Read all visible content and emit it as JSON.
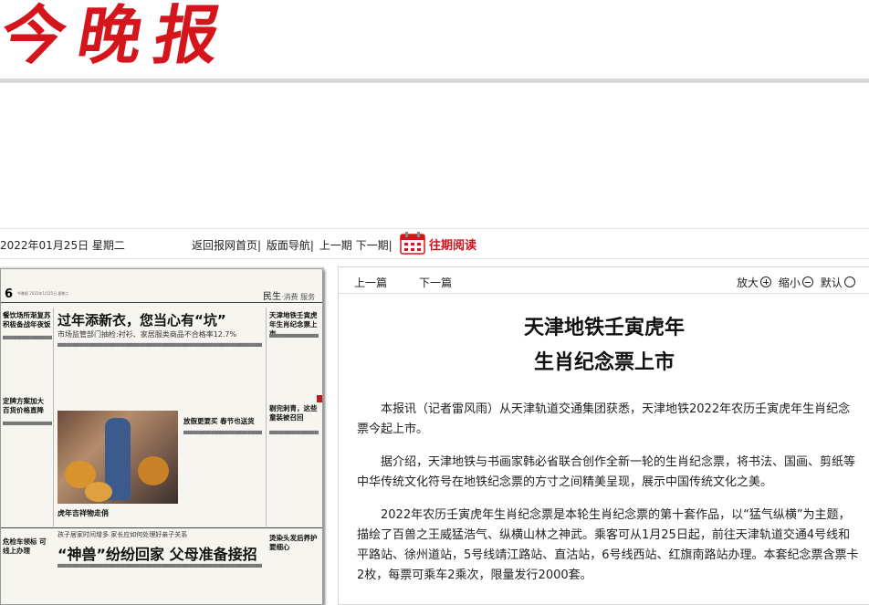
{
  "masthead": {
    "logo_text": "今晚报"
  },
  "nav": {
    "date": "2022年01月25日 星期二",
    "links": [
      "返回报网首页",
      "版面导航",
      "上一期",
      "下一期"
    ],
    "past_reading": "往期阅读"
  },
  "page": {
    "number": "6",
    "section": "民生",
    "section_sub": "·消费 服务",
    "headline_main": "过年添新衣，您当心有“坑”",
    "headline_sub": "市场监管部门抽检:衬衫、家居服类商品不合格率12.7%",
    "photo_caption": "虎年吉祥物走俏",
    "kicker2": "孩子居家时间增多 家长应如何处理好亲子关系",
    "headline2": "“神兽”纷纷回家 父母准备接招",
    "side_items": [
      "天津地铁壬寅虎年生肖纪念票上市",
      "剔完刺青，这些童装被召回",
      "烫染头发后养护要细心",
      "放假更要买 春节也送货",
      "餐饮场所渐复苏 积极备战年夜饭",
      "定牌方案加大 百货价格直降",
      "危检车领标 可线上办理"
    ]
  },
  "article": {
    "prev_label": "上一篇",
    "next_label": "下一篇",
    "zoom_in": "放大",
    "zoom_out": "缩小",
    "zoom_default": "默认",
    "title_line1": "天津地铁壬寅虎年",
    "title_line2": "生肖纪念票上市",
    "paragraphs": [
      "本报讯（记者雷风雨）从天津轨道交通集团获悉，天津地铁2022年农历壬寅虎年生肖纪念票今起上市。",
      "据介绍，天津地铁与书画家韩必省联合创作全新一轮的生肖纪念票，将书法、国画、剪纸等中华传统文化符号在地铁纪念票的方寸之间精美呈现，展示中国传统文化之美。",
      "2022年农历壬寅虎年生肖纪念票是本轮生肖纪念票的第十套作品，以“猛气纵横”为主题，描绘了百兽之王威猛浩气、纵横山林之神武。乘客可从1月25日起，前往天津轨道交通4号线和平路站、徐州道站，5号线靖江路站、直沽站，6号线西站、红旗南路站办理。本套纪念票含票卡2枚，每票可乘车2乘次，限量发行2000套。"
    ]
  },
  "colors": {
    "brand_red": "#d4161c",
    "accent_red": "#c8161d"
  }
}
